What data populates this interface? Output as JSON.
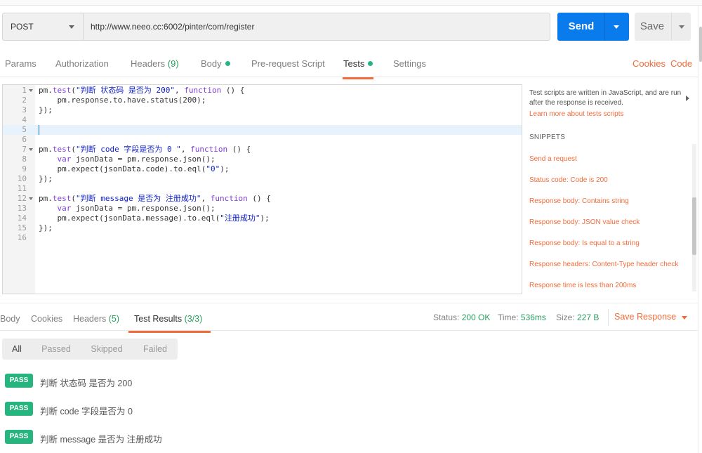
{
  "request": {
    "method": "POST",
    "url": "http://www.neeo.cc:6002/pinter/com/register",
    "send_label": "Send",
    "save_label": "Save"
  },
  "request_tabs": [
    {
      "label": "Params",
      "count": "",
      "dot": false,
      "active": false
    },
    {
      "label": "Authorization",
      "count": "",
      "dot": false,
      "active": false
    },
    {
      "label": "Headers",
      "count": "(9)",
      "dot": false,
      "active": false
    },
    {
      "label": "Body",
      "count": "",
      "dot": true,
      "active": false
    },
    {
      "label": "Pre-request Script",
      "count": "",
      "dot": false,
      "active": false
    },
    {
      "label": "Tests",
      "count": "",
      "dot": true,
      "active": true
    },
    {
      "label": "Settings",
      "count": "",
      "dot": false,
      "active": false
    }
  ],
  "right_links": {
    "cookies": "Cookies",
    "code": "Code"
  },
  "editor": {
    "current_line": 5,
    "lines": [
      {
        "n": "1",
        "fold": true,
        "tokens": [
          [
            "pm.",
            ""
          ],
          [
            "test",
            "kw"
          ],
          [
            "(",
            ""
          ],
          [
            "\"判断 状态码 是否为 200\"",
            "str"
          ],
          [
            ", ",
            ""
          ],
          [
            "function",
            "kw"
          ],
          [
            " () {",
            ""
          ]
        ]
      },
      {
        "n": "2",
        "fold": false,
        "tokens": [
          [
            "    pm.response.to.have.status(200);",
            ""
          ]
        ]
      },
      {
        "n": "3",
        "fold": false,
        "tokens": [
          [
            "});",
            ""
          ]
        ]
      },
      {
        "n": "4",
        "fold": false,
        "tokens": []
      },
      {
        "n": "5",
        "fold": false,
        "tokens": []
      },
      {
        "n": "6",
        "fold": false,
        "tokens": []
      },
      {
        "n": "7",
        "fold": true,
        "tokens": [
          [
            "pm.",
            ""
          ],
          [
            "test",
            "kw"
          ],
          [
            "(",
            ""
          ],
          [
            "\"判断 code 字段是否为 0 \"",
            "str"
          ],
          [
            ", ",
            ""
          ],
          [
            "function",
            "kw"
          ],
          [
            " () {",
            ""
          ]
        ]
      },
      {
        "n": "8",
        "fold": false,
        "tokens": [
          [
            "    ",
            ""
          ],
          [
            "var",
            "kw"
          ],
          [
            " jsonData = pm.response.json();",
            ""
          ]
        ]
      },
      {
        "n": "9",
        "fold": false,
        "tokens": [
          [
            "    pm.expect(jsonData.code).to.eql(",
            ""
          ],
          [
            "\"0\"",
            "str"
          ],
          [
            ");",
            ""
          ]
        ]
      },
      {
        "n": "10",
        "fold": false,
        "tokens": [
          [
            "});",
            ""
          ]
        ]
      },
      {
        "n": "11",
        "fold": false,
        "tokens": []
      },
      {
        "n": "12",
        "fold": true,
        "tokens": [
          [
            "pm.",
            ""
          ],
          [
            "test",
            "kw"
          ],
          [
            "(",
            ""
          ],
          [
            "\"判断 message 是否为 注册成功\"",
            "str"
          ],
          [
            ", ",
            ""
          ],
          [
            "function",
            "kw"
          ],
          [
            " () {",
            ""
          ]
        ]
      },
      {
        "n": "13",
        "fold": false,
        "tokens": [
          [
            "    ",
            ""
          ],
          [
            "var",
            "kw"
          ],
          [
            " jsonData = pm.response.json();",
            ""
          ]
        ]
      },
      {
        "n": "14",
        "fold": false,
        "tokens": [
          [
            "    pm.expect(jsonData.message).to.eql(",
            ""
          ],
          [
            "\"注册成功\"",
            "str"
          ],
          [
            ");",
            ""
          ]
        ]
      },
      {
        "n": "15",
        "fold": false,
        "tokens": [
          [
            "});",
            ""
          ]
        ]
      },
      {
        "n": "16",
        "fold": false,
        "tokens": []
      }
    ]
  },
  "side_panel": {
    "help_text": "Test scripts are written in JavaScript, and are run after the response is received.",
    "learn_link": "Learn more about tests scripts",
    "snippets_heading": "SNIPPETS",
    "snippets": [
      "Send a request",
      "Status code: Code is 200",
      "Response body: Contains string",
      "Response body: JSON value check",
      "Response body: Is equal to a string",
      "Response headers: Content-Type header check",
      "Response time is less than 200ms"
    ]
  },
  "response_tabs": [
    {
      "label": "Body",
      "count": "",
      "active": false
    },
    {
      "label": "Cookies",
      "count": "",
      "active": false
    },
    {
      "label": "Headers",
      "count": "(5)",
      "active": false
    },
    {
      "label": "Test Results",
      "count": "(3/3)",
      "active": true
    }
  ],
  "response_stats": {
    "status_label": "Status:",
    "status_value": "200 OK",
    "time_label": "Time:",
    "time_value": "536ms",
    "size_label": "Size:",
    "size_value": "227 B"
  },
  "save_response_label": "Save Response",
  "filters": [
    {
      "label": "All",
      "active": true
    },
    {
      "label": "Passed",
      "active": false
    },
    {
      "label": "Skipped",
      "active": false
    },
    {
      "label": "Failed",
      "active": false
    }
  ],
  "results": [
    {
      "badge": "PASS",
      "text": "判断 状态码 是否为 200"
    },
    {
      "badge": "PASS",
      "text": "判断 code 字段是否为 0"
    },
    {
      "badge": "PASS",
      "text": "判断 message 是否为 注册成功"
    }
  ],
  "colors": {
    "accent": "#f26b3a",
    "send": "#097bed",
    "pass": "#26b47f",
    "keyword": "#7d3ed7",
    "string": "#0f20c8"
  }
}
